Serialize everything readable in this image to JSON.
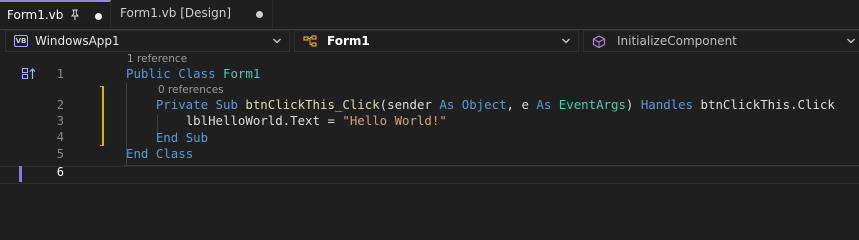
{
  "tabs": [
    {
      "label": "Form1.vb",
      "active": true,
      "pinned": true,
      "modified": true
    },
    {
      "label": "Form1.vb [Design]",
      "active": false,
      "modified": true
    }
  ],
  "navbar": {
    "project": {
      "label": "WindowsApp1",
      "icon": "vb-project-icon"
    },
    "type": {
      "label": "Form1",
      "icon": "class-icon"
    },
    "member": {
      "label": "InitializeComponent",
      "icon": "method-icon"
    }
  },
  "editor": {
    "codelens": [
      {
        "text": "1 reference",
        "before_line": 1
      },
      {
        "text": "0 references",
        "before_line": 2
      }
    ],
    "line_numbers": [
      "1",
      "2",
      "3",
      "4",
      "5",
      "6"
    ],
    "lines": [
      [
        {
          "t": "Public",
          "k": "kw"
        },
        {
          "t": " "
        },
        {
          "t": "Class",
          "k": "kw"
        },
        {
          "t": " "
        },
        {
          "t": "Form1",
          "k": "cls"
        }
      ],
      [
        {
          "t": "    "
        },
        {
          "t": "Private",
          "k": "kw"
        },
        {
          "t": " "
        },
        {
          "t": "Sub",
          "k": "kw"
        },
        {
          "t": " "
        },
        {
          "t": "btnClickThis_Click",
          "k": "fn"
        },
        {
          "t": "("
        },
        {
          "t": "sender"
        },
        {
          "t": " "
        },
        {
          "t": "As",
          "k": "kw"
        },
        {
          "t": " "
        },
        {
          "t": "Object",
          "k": "kw"
        },
        {
          "t": ", "
        },
        {
          "t": "e"
        },
        {
          "t": " "
        },
        {
          "t": "As",
          "k": "kw"
        },
        {
          "t": " "
        },
        {
          "t": "EventArgs",
          "k": "cls"
        },
        {
          "t": ") "
        },
        {
          "t": "Handles",
          "k": "kw"
        },
        {
          "t": " "
        },
        {
          "t": "btnClickThis"
        },
        {
          "t": "."
        },
        {
          "t": "Click"
        }
      ],
      [
        {
          "t": "        "
        },
        {
          "t": "lblHelloWorld"
        },
        {
          "t": "."
        },
        {
          "t": "Text"
        },
        {
          "t": " = "
        },
        {
          "t": "\"Hello World!\"",
          "k": "str"
        }
      ],
      [
        {
          "t": "    "
        },
        {
          "t": "End",
          "k": "kw"
        },
        {
          "t": " "
        },
        {
          "t": "Sub",
          "k": "kw"
        }
      ],
      [
        {
          "t": "End",
          "k": "kw"
        },
        {
          "t": " "
        },
        {
          "t": "Class",
          "k": "kw"
        }
      ],
      []
    ],
    "current_line": "6"
  },
  "colors": {
    "background": "#1f1f1f",
    "keyword": "#569cd6",
    "type": "#4ec9b0",
    "method": "#dcdcaa",
    "string": "#d69d85",
    "active_tab_accent": "#9184ee",
    "change_marker": "#d7b600"
  }
}
